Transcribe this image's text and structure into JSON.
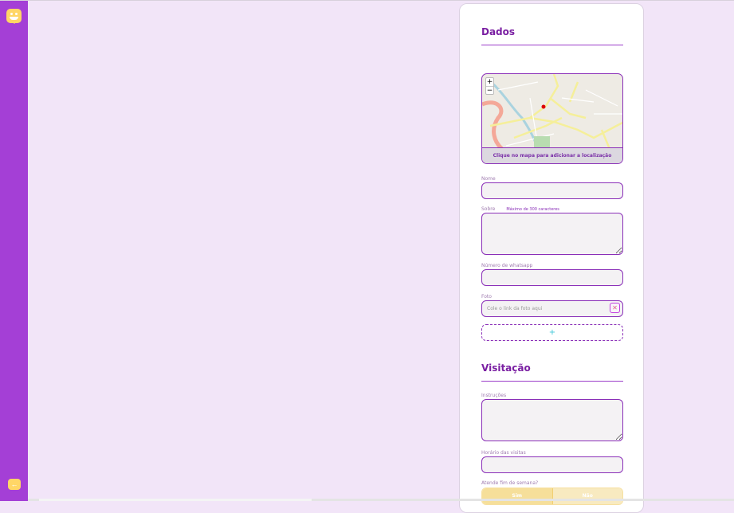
{
  "sidebar": {
    "logo": "happy-logo",
    "back": "←"
  },
  "dados": {
    "title": "Dados",
    "map": {
      "zoom_in": "+",
      "zoom_out": "−",
      "hint": "Clique no mapa para adicionar a localização"
    },
    "nome_label": "Nome",
    "sobre_label": "Sobre",
    "sobre_hint": "Máximo de 300 caracteres",
    "whatsapp_label": "Número de whatsapp",
    "foto_label": "Foto",
    "foto_placeholder": "Cole o link da foto aqui",
    "foto_remove": "✕",
    "add": "+"
  },
  "visitacao": {
    "title": "Visitação",
    "instrucoes_label": "Instruções",
    "horario_label": "Horário das visitas",
    "weekend_label": "Atende fim de semana?",
    "yes": "Sim",
    "no": "Não"
  },
  "colors": {
    "sidebar": "#a43fd6",
    "accent": "#8a2fb8",
    "background": "#f2e5f8",
    "logo": "#ffd666"
  }
}
